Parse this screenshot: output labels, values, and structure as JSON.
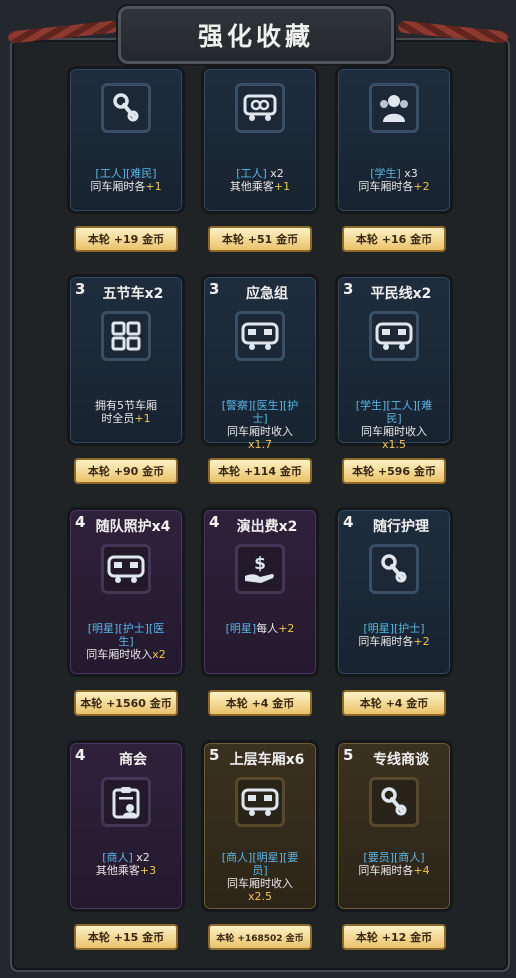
{
  "header": {
    "title": "强化收藏"
  },
  "cards": [
    {
      "id": "c1",
      "level": "",
      "name": "",
      "icon": "wrench-icon",
      "color": "blue",
      "lines": [
        [
          "[工人][难民]"
        ],
        [
          "同车厢时各",
          "+1"
        ]
      ],
      "reward": "本轮 +19 金币"
    },
    {
      "id": "c2",
      "level": "",
      "name": "",
      "icon": "train-link-icon",
      "color": "blue",
      "lines": [
        [
          "[工人]",
          " x2"
        ],
        [
          "其他乘客",
          "+1"
        ]
      ],
      "reward": "本轮 +51 金币"
    },
    {
      "id": "c3",
      "level": "",
      "name": "",
      "icon": "people-group-icon",
      "color": "blue",
      "lines": [
        [
          "[学生]",
          " x3"
        ],
        [
          "同车厢时各",
          "+2"
        ]
      ],
      "reward": "本轮 +16 金币"
    },
    {
      "id": "c4",
      "level": "3",
      "name": "五节车x2",
      "icon": "grid-four-icon",
      "color": "blue",
      "lines": [
        [
          "拥有5节车厢"
        ],
        [
          "时全员",
          "+1"
        ]
      ],
      "reward": "本轮 +90 金币"
    },
    {
      "id": "c5",
      "level": "3",
      "name": "应急组",
      "icon": "train-car-icon",
      "color": "blue",
      "lines": [
        [
          "[警察][医生][护"
        ],
        [
          "士]"
        ],
        [
          "同车厢时收入"
        ],
        [
          "x1.7"
        ]
      ],
      "reward": "本轮 +114 金币"
    },
    {
      "id": "c6",
      "level": "3",
      "name": "平民线x2",
      "icon": "train-car-icon",
      "color": "blue",
      "lines": [
        [
          "[学生][工人][难"
        ],
        [
          "民]"
        ],
        [
          "同车厢时收入"
        ],
        [
          "x1.5"
        ]
      ],
      "reward": "本轮 +596 金币"
    },
    {
      "id": "c7",
      "level": "4",
      "name": "随队照护x4",
      "icon": "train-car-icon",
      "color": "purple",
      "lines": [
        [
          "[明星][护士][医"
        ],
        [
          "生]"
        ],
        [
          "同车厢时收入",
          "x2"
        ]
      ],
      "reward": "本轮 +1560 金币"
    },
    {
      "id": "c8",
      "level": "4",
      "name": "演出费x2",
      "icon": "money-hand-icon",
      "color": "purple",
      "lines": [
        [
          "[明星]",
          "每人",
          "+2"
        ]
      ],
      "reward": "本轮 +4 金币"
    },
    {
      "id": "c9",
      "level": "4",
      "name": "随行护理",
      "icon": "wrench-icon",
      "color": "blue",
      "lines": [
        [
          "[明星][护士]"
        ],
        [
          "同车厢时各",
          "+2"
        ]
      ],
      "reward": "本轮 +4 金币"
    },
    {
      "id": "c10",
      "level": "4",
      "name": "商会",
      "icon": "clipboard-user-icon",
      "color": "purple",
      "lines": [
        [
          "[商人]",
          " x2"
        ],
        [
          "其他乘客",
          "+3"
        ]
      ],
      "reward": "本轮 +15 金币"
    },
    {
      "id": "c11",
      "level": "5",
      "name": "上层车厢x6",
      "icon": "train-car-icon",
      "color": "gold",
      "lines": [
        [
          "[商人][明星][要"
        ],
        [
          "员]"
        ],
        [
          "同车厢时收入"
        ],
        [
          "x2.5"
        ]
      ],
      "reward": "本轮 +168502 金币"
    },
    {
      "id": "c12",
      "level": "5",
      "name": "专线商谈",
      "icon": "wrench-icon",
      "color": "gold",
      "lines": [
        [
          "[要员][商人]"
        ],
        [
          "同车厢时各",
          "+4"
        ]
      ],
      "reward": "本轮 +12 金币"
    }
  ]
}
